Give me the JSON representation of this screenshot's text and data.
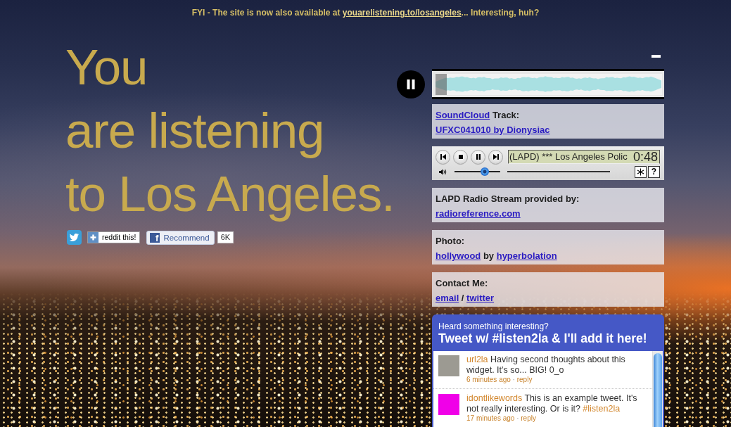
{
  "banner": [
    {
      "kind": "text",
      "text": "FYI - The site is now also available at "
    },
    {
      "kind": "link",
      "text": "youarelistening.to/losangeles"
    },
    {
      "kind": "text",
      "text": "... Interesting, huh?"
    }
  ],
  "headline": [
    "You",
    "are listening",
    "to Los Angeles."
  ],
  "share": {
    "reddit_label": "reddit this!",
    "facebook_logo": "f",
    "facebook_label": "Recommend",
    "facebook_count": "6K"
  },
  "soundcloud_player": {
    "playing": true,
    "level": 0.05
  },
  "panels": [
    {
      "kind": "credits",
      "lines": [
        [
          {
            "kind": "link",
            "text": "SoundCloud"
          },
          {
            "kind": "text",
            "text": " Track:"
          }
        ],
        [
          {
            "kind": "link",
            "text": "UFXC041010 by Dionysiac"
          }
        ]
      ]
    },
    {
      "kind": "radio",
      "display_text": "(LAPD) *** Los Angeles Polic",
      "time": "0:48",
      "volume": {
        "level": 0.7
      },
      "help_label": "?"
    },
    {
      "kind": "credits",
      "lines": [
        [
          {
            "kind": "text",
            "text": "LAPD Radio Stream provided by:"
          }
        ],
        [
          {
            "kind": "link",
            "text": "radioreference.com"
          }
        ]
      ]
    },
    {
      "kind": "credits",
      "lines": [
        [
          {
            "kind": "text",
            "text": "Photo:"
          }
        ],
        [
          {
            "kind": "link",
            "text": "hollywood"
          },
          {
            "kind": "text",
            "text": " by "
          },
          {
            "kind": "link",
            "text": "hyperbolation"
          }
        ]
      ]
    },
    {
      "kind": "credits",
      "lines": [
        [
          {
            "kind": "text",
            "text": "Contact Me:"
          }
        ],
        [
          {
            "kind": "link",
            "text": "email"
          },
          {
            "kind": "text",
            "text": " / "
          },
          {
            "kind": "link",
            "text": "twitter"
          }
        ]
      ]
    }
  ],
  "twitter_widget": {
    "subtitle": "Heard something interesting?",
    "title": "Tweet w/ #listen2la & I'll add it here!",
    "tweets": [
      {
        "user": "url2la",
        "text": "Having second thoughts about this widget. It's so... BIG! 0_o",
        "time": "6 minutes ago",
        "separator": "·",
        "reply": "reply",
        "color": "#9c9a92"
      },
      {
        "user": "idontlikewords",
        "text": "This is an example tweet. It's not really interesting. Or is it?",
        "hashtag": "#listen2la",
        "time": "17 minutes ago",
        "separator": "·",
        "reply": "reply",
        "color": "#f000e8"
      }
    ]
  }
}
